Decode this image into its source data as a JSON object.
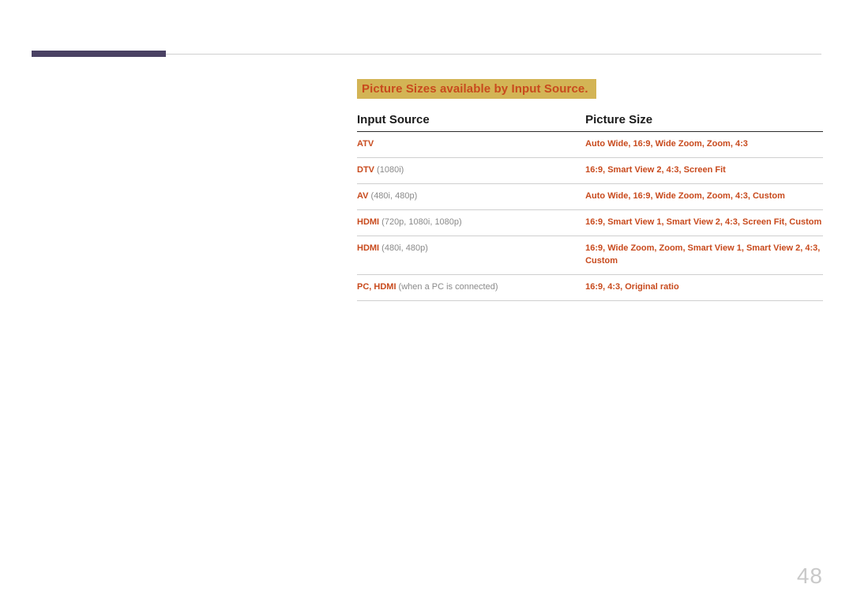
{
  "section_title": "Picture Sizes available by Input Source.",
  "headers": {
    "left": "Input Source",
    "right": "Picture Size"
  },
  "rows": [
    {
      "src_strong": "ATV",
      "src_note": "",
      "sizes": "Auto Wide, 16:9, Wide Zoom, Zoom, 4:3"
    },
    {
      "src_strong": "DTV",
      "src_note": " (1080i)",
      "sizes": "16:9, Smart View 2, 4:3, Screen Fit"
    },
    {
      "src_strong": "AV",
      "src_note": " (480i, 480p)",
      "sizes": "Auto Wide, 16:9, Wide Zoom, Zoom, 4:3, Custom"
    },
    {
      "src_strong": "HDMI",
      "src_note": " (720p, 1080i, 1080p)",
      "sizes": "16:9, Smart View 1, Smart View 2, 4:3, Screen Fit, Custom"
    },
    {
      "src_strong": "HDMI",
      "src_note": " (480i, 480p)",
      "sizes": "16:9, Wide Zoom, Zoom, Smart View 1, Smart View 2, 4:3, Custom"
    },
    {
      "src_strong": "PC, HDMI",
      "src_note": " (when a PC is connected)",
      "sizes": "16:9, 4:3, Original ratio"
    }
  ],
  "page_number": "48"
}
